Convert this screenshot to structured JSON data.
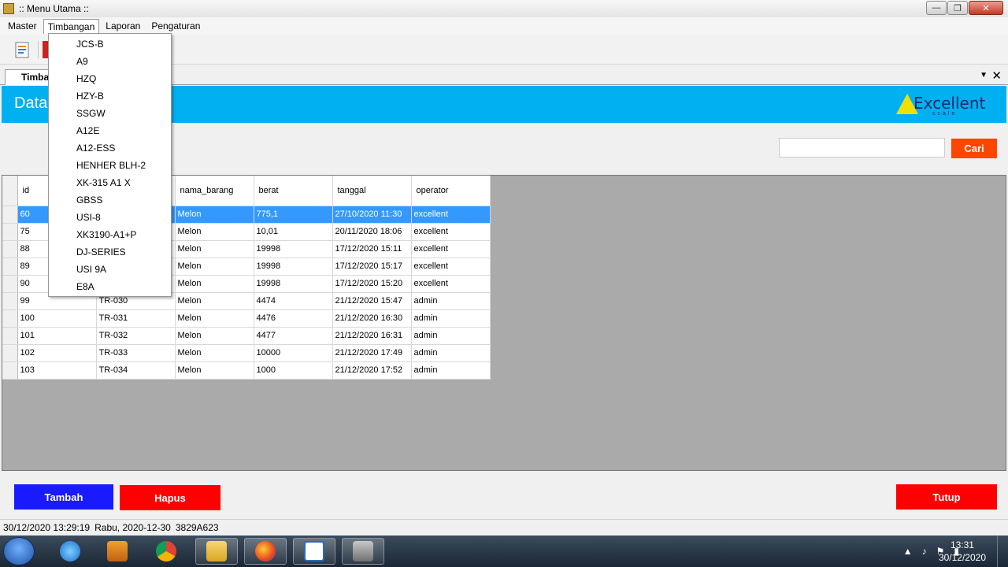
{
  "window": {
    "title": ":: Menu Utama ::"
  },
  "menubar": {
    "items": [
      "Master",
      "Timbangan",
      "Laporan",
      "Pengaturan"
    ]
  },
  "tab": {
    "label": "Timba"
  },
  "header": {
    "title": "Data",
    "logo_text": "Excellent",
    "logo_sub": "scale"
  },
  "search": {
    "value": "",
    "placeholder": "",
    "button": "Cari"
  },
  "timbangan_menu": [
    "JCS-B",
    "A9",
    "HZQ",
    "HZY-B",
    "SSGW",
    "A12E",
    "A12-ESS",
    "HENHER BLH-2",
    "XK-315 A1 X",
    "GBSS",
    "USI-8",
    "XK3190-A1+P",
    "DJ-SERIES",
    "USI 9A",
    "E8A"
  ],
  "grid": {
    "columns": [
      "id",
      "",
      "nama_barang",
      "berat",
      "tanggal",
      "operator"
    ],
    "rows": [
      {
        "id": "60",
        "kode": "",
        "nama": "Melon",
        "berat": "775,1",
        "tanggal": "27/10/2020 11:30",
        "operator": "excellent"
      },
      {
        "id": "75",
        "kode": "",
        "nama": "Melon",
        "berat": "10,01",
        "tanggal": "20/11/2020 18:06",
        "operator": "excellent"
      },
      {
        "id": "88",
        "kode": "",
        "nama": "Melon",
        "berat": "19998",
        "tanggal": "17/12/2020 15:11",
        "operator": "excellent"
      },
      {
        "id": "89",
        "kode": "",
        "nama": "Melon",
        "berat": "19998",
        "tanggal": "17/12/2020 15:17",
        "operator": "excellent"
      },
      {
        "id": "90",
        "kode": "",
        "nama": "Melon",
        "berat": "19998",
        "tanggal": "17/12/2020 15:20",
        "operator": "excellent"
      },
      {
        "id": "99",
        "kode": "TR-030",
        "nama": "Melon",
        "berat": "4474",
        "tanggal": "21/12/2020 15:47",
        "operator": "admin"
      },
      {
        "id": "100",
        "kode": "TR-031",
        "nama": "Melon",
        "berat": "4476",
        "tanggal": "21/12/2020 16:30",
        "operator": "admin"
      },
      {
        "id": "101",
        "kode": "TR-032",
        "nama": "Melon",
        "berat": "4477",
        "tanggal": "21/12/2020 16:31",
        "operator": "admin"
      },
      {
        "id": "102",
        "kode": "TR-033",
        "nama": "Melon",
        "berat": "10000",
        "tanggal": "21/12/2020 17:49",
        "operator": "admin"
      },
      {
        "id": "103",
        "kode": "TR-034",
        "nama": "Melon",
        "berat": "1000",
        "tanggal": "21/12/2020 17:52",
        "operator": "admin"
      }
    ]
  },
  "buttons": {
    "tambah": "Tambah",
    "hapus": "Hapus",
    "tutup": "Tutup"
  },
  "statusbar": {
    "datetime": "30/12/2020 13:29:19",
    "day": "Rabu, 2020-12-30",
    "code": "3829A623"
  },
  "taskbar": {
    "time": "13:31",
    "date": "30/12/2020"
  },
  "colors": {
    "header": "#00b0f0",
    "selected_row": "#3399ff",
    "cari": "#ff4500",
    "tambah": "#1a1aff",
    "hapus": "#ff0000",
    "tutup": "#ff0000"
  }
}
